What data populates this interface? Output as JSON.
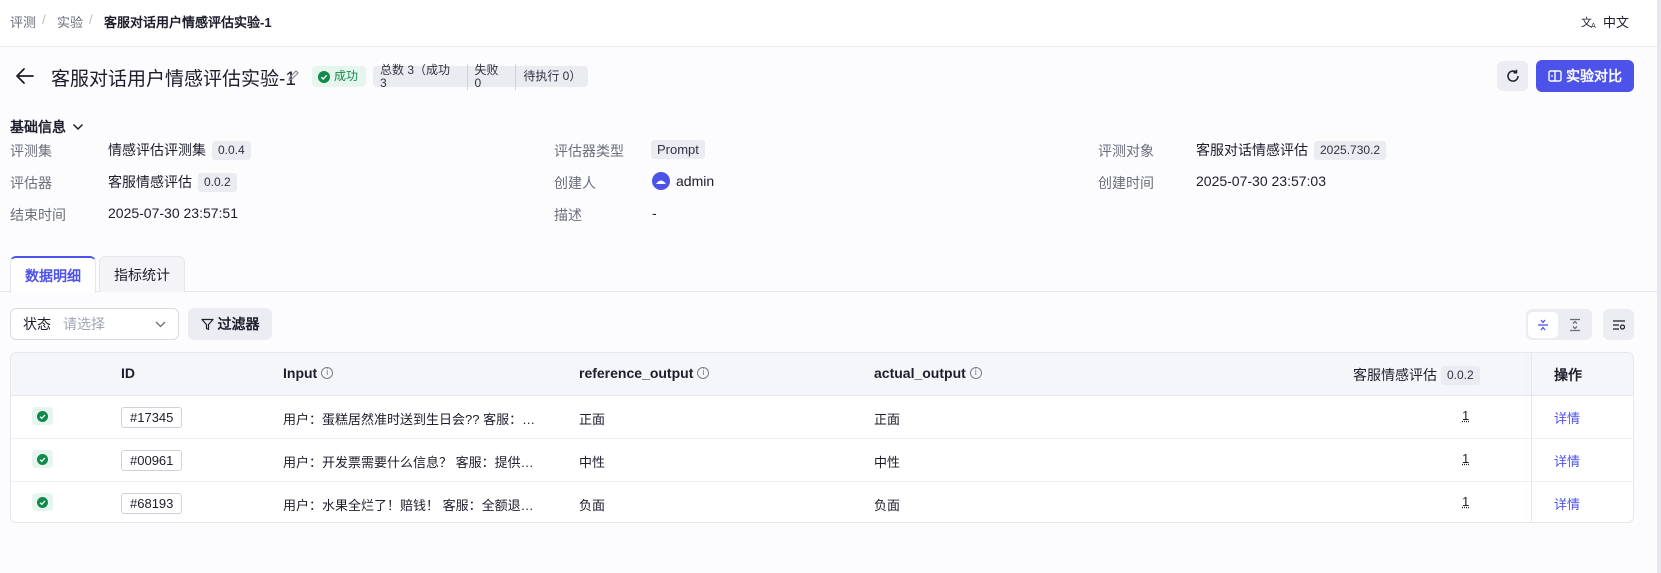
{
  "breadcrumb": {
    "items": [
      "评测",
      "实验",
      "客服对话用户情感评估实验-1"
    ],
    "separator": "/"
  },
  "language": {
    "label": "中文",
    "icon": "translate-icon"
  },
  "header": {
    "title": "客服对话用户情感评估实验-1",
    "status": "成功",
    "counts": [
      "总数 3（成功 3",
      "失败 0",
      "待执行 0）"
    ],
    "compare_label": "实验对比"
  },
  "basic_info": {
    "title": "基础信息",
    "eval_set_label": "评测集",
    "eval_set_value": "情感评估评测集",
    "eval_set_version": "0.0.4",
    "evaluator_type_label": "评估器类型",
    "evaluator_type_value": "Prompt",
    "target_label": "评测对象",
    "target_value": "客服对话情感评估",
    "target_version": "2025.730.2",
    "evaluator_label": "评估器",
    "evaluator_value": "客服情感评估",
    "evaluator_version": "0.0.2",
    "creator_label": "创建人",
    "creator_value": "admin",
    "created_time_label": "创建时间",
    "created_time_value": "2025-07-30 23:57:03",
    "end_time_label": "结束时间",
    "end_time_value": "2025-07-30 23:57:51",
    "desc_label": "描述",
    "desc_value": "-"
  },
  "tabs": [
    {
      "label": "数据明细",
      "active": true
    },
    {
      "label": "指标统计",
      "active": false
    }
  ],
  "filters": {
    "status_label": "状态",
    "status_placeholder": "请选择",
    "filter_label": "过滤器"
  },
  "table": {
    "columns": {
      "id": "ID",
      "input": "Input",
      "reference": "reference_output",
      "actual": "actual_output",
      "evaluator": "客服情感评估",
      "evaluator_version": "0.0.2",
      "action": "操作"
    },
    "rows": [
      {
        "id": "#17345",
        "input": "用户：蛋糕居然准时送到生日会?? 客服：…",
        "reference": "正面",
        "actual": "正面",
        "score": "1",
        "action": "详情"
      },
      {
        "id": "#00961",
        "input": "用户：开发票需要什么信息？ 客服：提供…",
        "reference": "中性",
        "actual": "中性",
        "score": "1",
        "action": "详情"
      },
      {
        "id": "#68193",
        "input": "用户：水果全烂了！赔钱！ 客服：全额退…",
        "reference": "负面",
        "actual": "负面",
        "score": "1",
        "action": "详情"
      }
    ]
  },
  "colors": {
    "accent": "#4d53e8",
    "success": "#0f8a4b",
    "success_bg": "#e6f6ee"
  }
}
